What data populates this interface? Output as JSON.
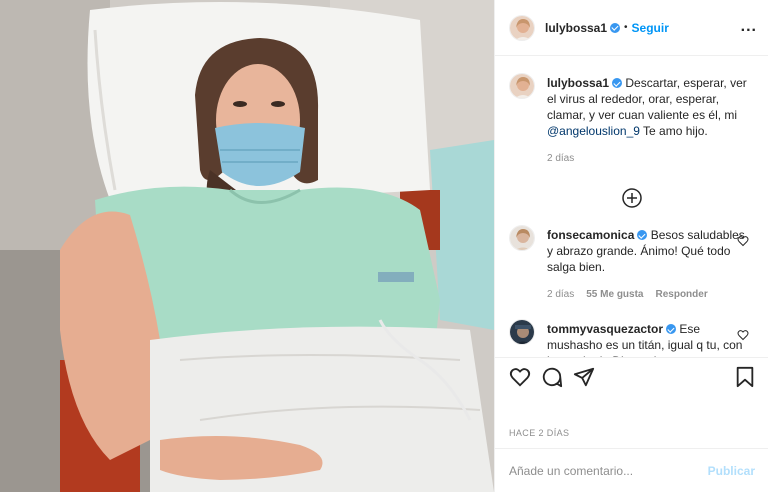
{
  "post": {
    "username": "lulybossa1",
    "follow_label": "Seguir",
    "separator": "•",
    "more_label": "...",
    "caption": {
      "username": "lulybossa1",
      "text": "Descartar, esperar, ver el virus al rededor, orar, esperar, clamar, y ver cuan valiente es él, mi",
      "mention": "@angelouslion_9",
      "text_end": "Te amo hijo.",
      "time": "2 días"
    },
    "comments": [
      {
        "username": "fonsecamonica",
        "text": "Besos saludables y abrazo grande. Ánimo! Qué todo salga bien.",
        "time": "2 días",
        "likes": "55 Me gusta",
        "reply": "Responder"
      },
      {
        "username": "tommyvasquezactor",
        "text": "Ese mushasho es un titán, igual q tu, con la uyuda de Dios todo va a",
        "time": "",
        "likes": "",
        "reply": ""
      }
    ],
    "date_label": "HACE 2 DÍAS",
    "comment_placeholder": "Añade un comentario...",
    "publish_label": "Publicar"
  },
  "colors": {
    "link": "#0095f6",
    "verified": "#3897f0",
    "muted": "#8e8e8e",
    "publish_disabled": "#b2dffc"
  },
  "icons": [
    "more-options-icon",
    "verified-badge-icon",
    "load-more-icon",
    "heart-icon",
    "comment-icon",
    "share-icon",
    "save-icon"
  ]
}
